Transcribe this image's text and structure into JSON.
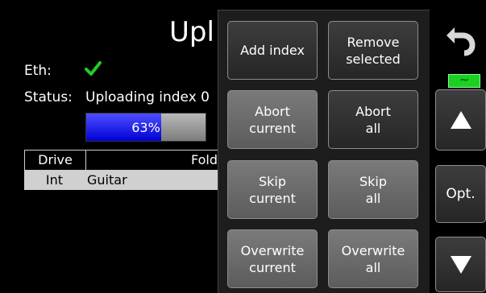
{
  "screen": {
    "title": "Upl",
    "eth_label": "Eth:",
    "eth_status_icon": "check-icon",
    "status_label": "Status:",
    "status_text": "Uploading index 0",
    "progress_text": "63%",
    "progress_value": 0.63,
    "table": {
      "headers": [
        "Drive",
        "Fold"
      ],
      "rows": [
        {
          "drive": "Int",
          "folder": "Guitar"
        }
      ]
    }
  },
  "popup": {
    "buttons": [
      {
        "label": "Add index",
        "enabled": true
      },
      {
        "label": "Remove\nselected",
        "enabled": true
      },
      {
        "label": "Abort\ncurrent",
        "enabled": false
      },
      {
        "label": "Abort\nall",
        "enabled": true
      },
      {
        "label": "Skip\ncurrent",
        "enabled": false
      },
      {
        "label": "Skip\nall",
        "enabled": false
      },
      {
        "label": "Overwrite\ncurrent",
        "enabled": false
      },
      {
        "label": "Overwrite\nall",
        "enabled": false
      }
    ]
  },
  "sidebar": {
    "undo_icon": "undo-icon",
    "toggle_label": "~",
    "up_icon": "arrow-up-icon",
    "opt_label": "Opt.",
    "down_icon": "arrow-down-icon"
  },
  "colors": {
    "progress_fill": "#0000d6",
    "check": "#22cc22",
    "toggle": "#19d11f"
  }
}
